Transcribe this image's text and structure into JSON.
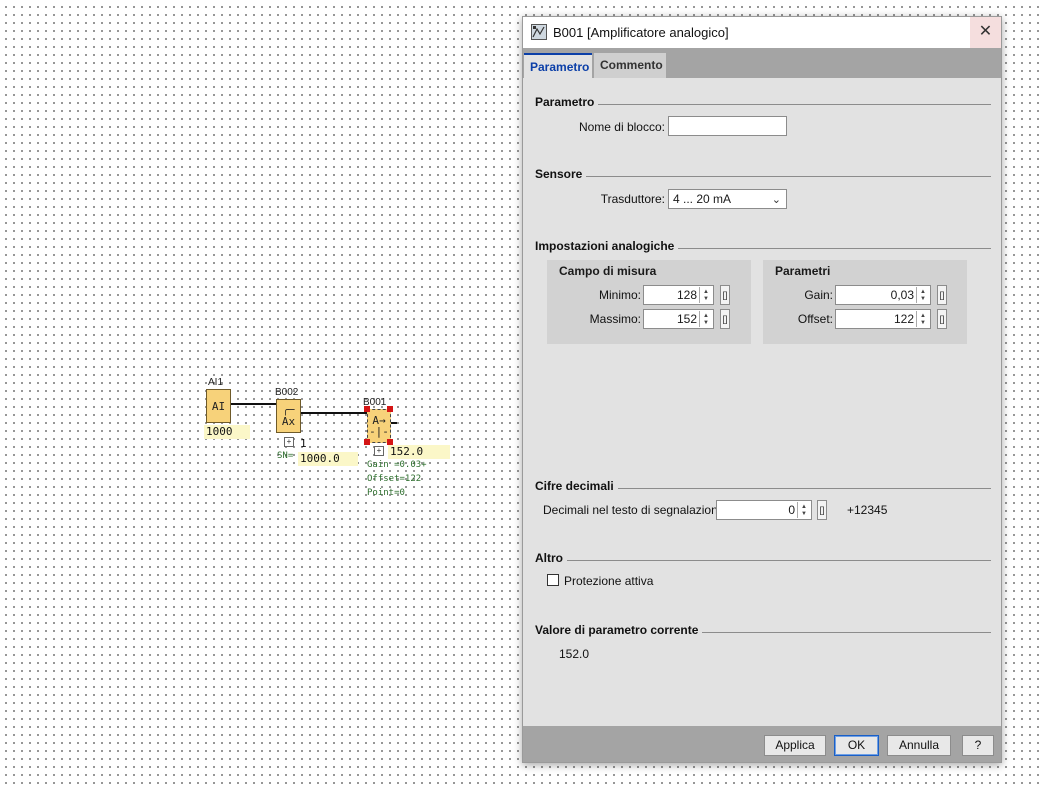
{
  "diagram": {
    "ai_block": {
      "label": "AI1",
      "text": "AI",
      "value": "1000"
    },
    "b002_block": {
      "label": "B002",
      "text": "Ax",
      "value": "1000.0",
      "count": "1",
      "param": "SN="
    },
    "b001_block": {
      "label": "B001",
      "value": "152.0",
      "params": [
        "Gain =0.03+",
        "Offset=122",
        "Point=0"
      ]
    }
  },
  "dialog": {
    "title": "B001 [Amplificatore analogico]",
    "close_symbol": "✕",
    "tabs": [
      {
        "label": "Parametro",
        "active": true
      },
      {
        "label": "Commento",
        "active": false
      }
    ],
    "parametro": {
      "section": "Parametro",
      "block_name_label": "Nome di blocco:",
      "block_name_value": ""
    },
    "sensore": {
      "section": "Sensore",
      "transducer_label": "Trasduttore:",
      "transducer_value": "4 ... 20 mA"
    },
    "impostazioni": {
      "section": "Impostazioni analogiche",
      "campo": {
        "title": "Campo di misura",
        "min_label": "Minimo:",
        "min_value": "128",
        "max_label": "Massimo:",
        "max_value": "152"
      },
      "parametri": {
        "title": "Parametri",
        "gain_label": "Gain:",
        "gain_value": "0,03",
        "offset_label": "Offset:",
        "offset_value": "122"
      }
    },
    "cifre": {
      "section": "Cifre decimali",
      "label": "Decimali nel testo di segnalazione:",
      "value": "0",
      "preview": "+12345"
    },
    "altro": {
      "section": "Altro",
      "checkbox_label": "Protezione attiva",
      "checked": false
    },
    "corrente": {
      "section": "Valore di parametro corrente",
      "value": "152.0"
    },
    "buttons": {
      "apply": "Applica",
      "ok": "OK",
      "cancel": "Annulla",
      "help": "?"
    }
  },
  "icons": {
    "spin_up": "▲",
    "spin_down": "▼",
    "chevron": "⌄",
    "bracket": "[]",
    "expand": "+"
  }
}
